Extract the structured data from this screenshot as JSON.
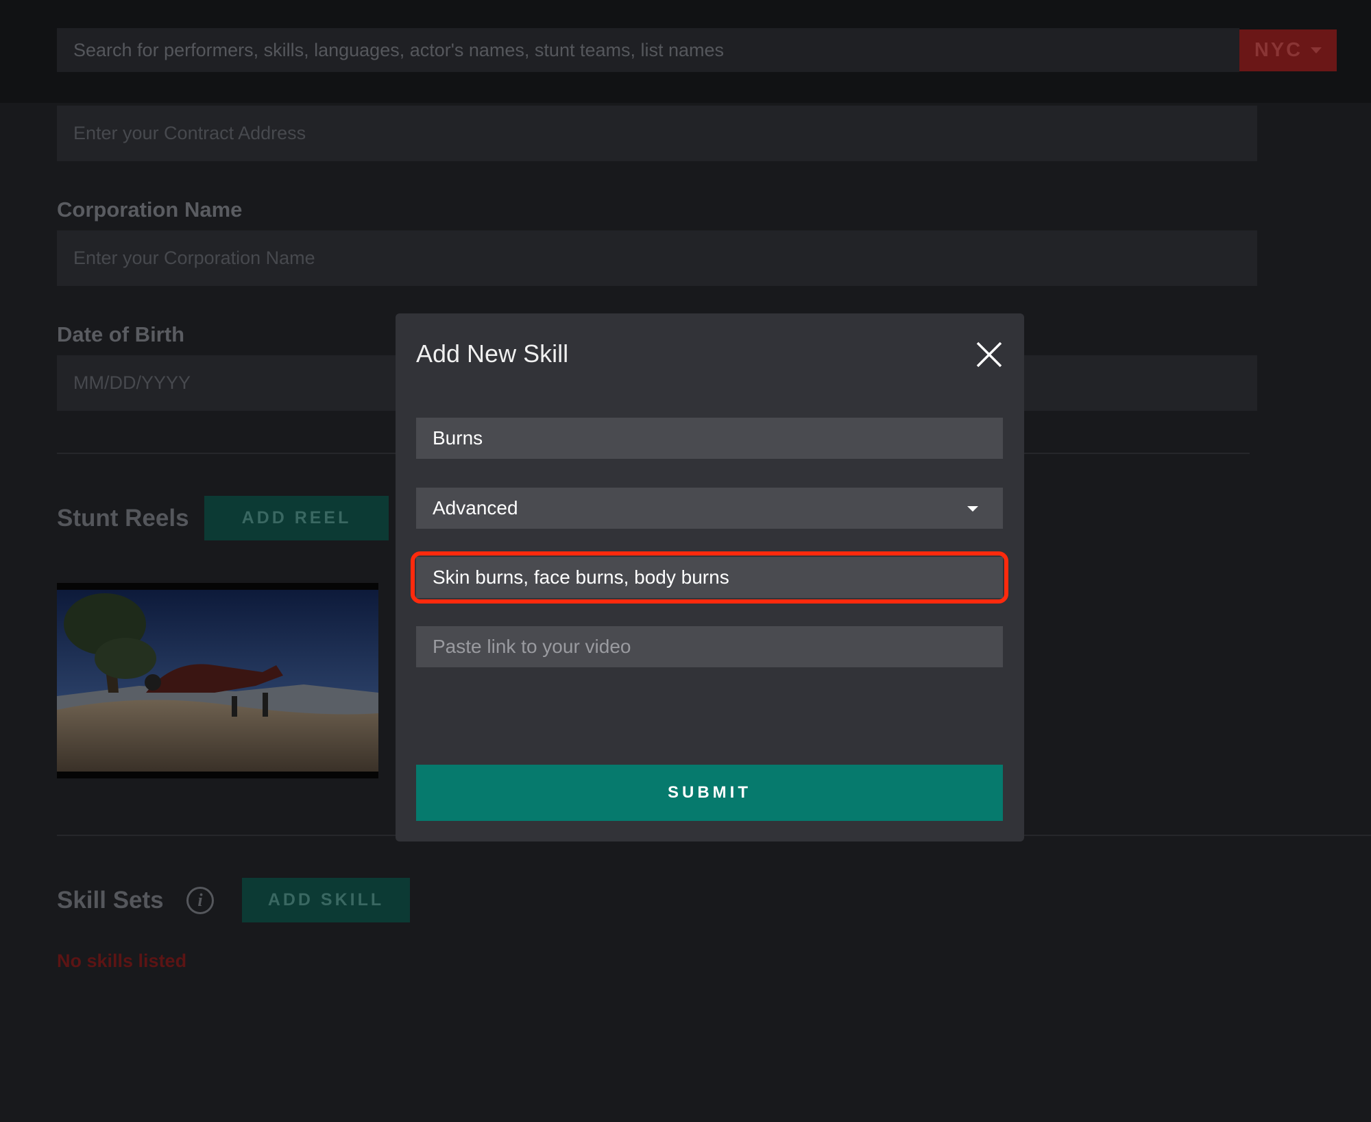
{
  "header": {
    "search_placeholder": "Search for performers, skills, languages, actor's names, stunt teams, list names",
    "city_label": "NYC"
  },
  "form": {
    "contract_address_placeholder": "Enter your Contract Address",
    "corporation_name_label": "Corporation Name",
    "corporation_name_placeholder": "Enter your Corporation Name",
    "date_of_birth_label": "Date of Birth",
    "date_of_birth_placeholder": "MM/DD/YYYY"
  },
  "stunt_reels": {
    "title": "Stunt Reels",
    "add_button_label": "ADD REEL"
  },
  "skill_sets": {
    "title": "Skill Sets",
    "info_symbol": "i",
    "add_button_label": "ADD SKILL",
    "empty_message": "No skills listed"
  },
  "modal": {
    "title": "Add New Skill",
    "skill_name_value": "Burns",
    "level_value": "Advanced",
    "description_value": "Skin burns, face burns, body burns",
    "video_link_placeholder": "Paste link to your video",
    "submit_label": "SUBMIT"
  },
  "colors": {
    "accent_teal": "#067a6d",
    "highlight_red": "#ff2a0d",
    "city_button_red": "#6b1717"
  }
}
